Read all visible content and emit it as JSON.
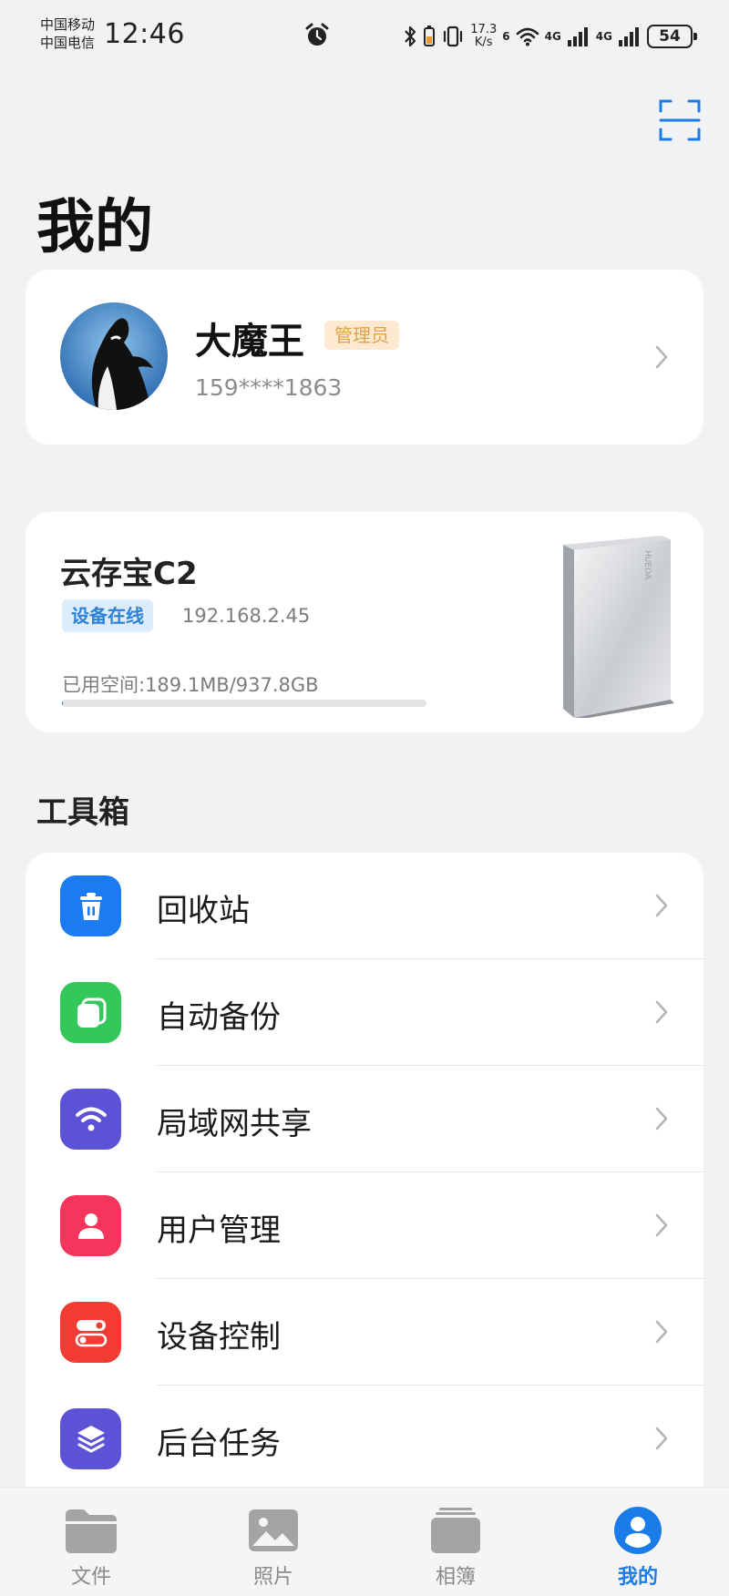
{
  "status_bar": {
    "carrier_1": "中国移动",
    "carrier_2": "中国电信",
    "time": "12:46",
    "net_speed_value": "17.3",
    "net_speed_unit": "K/s",
    "wifi_label": "6",
    "signal_1_label": "4G",
    "signal_2_label": "4G",
    "battery": "54",
    "icons": [
      "alarm-icon",
      "bluetooth-icon",
      "vibrate-icon",
      "wifi-icon",
      "signal-icon",
      "battery-icon"
    ]
  },
  "header": {
    "title": "我的",
    "scan_icon": "scan-icon"
  },
  "profile": {
    "name": "大魔王",
    "role": "管理员",
    "phone": "159****1863"
  },
  "device": {
    "name": "云存宝C2",
    "status": "设备在线",
    "ip": "192.168.2.45",
    "storage_text": "已用空间:189.1MB/937.8GB",
    "storage_progress": 0.0002,
    "brand_text": "HUEOA"
  },
  "toolbox": {
    "title": "工具箱",
    "items": [
      {
        "label": "回收站",
        "icon": "trash-icon",
        "color": "#1a7cf0"
      },
      {
        "label": "自动备份",
        "icon": "backup-icon",
        "color": "#34c759"
      },
      {
        "label": "局域网共享",
        "icon": "wifi-share-icon",
        "color": "#5b52d6"
      },
      {
        "label": "用户管理",
        "icon": "user-icon",
        "color": "#f5365c"
      },
      {
        "label": "设备控制",
        "icon": "toggle-icon",
        "color": "#f23c33"
      },
      {
        "label": "后台任务",
        "icon": "layers-icon",
        "color": "#5b52d6"
      }
    ]
  },
  "nav": {
    "items": [
      {
        "label": "文件",
        "icon": "folder-icon",
        "active": false
      },
      {
        "label": "照片",
        "icon": "photo-icon",
        "active": false
      },
      {
        "label": "相簿",
        "icon": "album-icon",
        "active": false
      },
      {
        "label": "我的",
        "icon": "profile-icon",
        "active": true
      }
    ],
    "active_color": "#1a7ce8",
    "inactive_color": "#8a8a8a"
  }
}
